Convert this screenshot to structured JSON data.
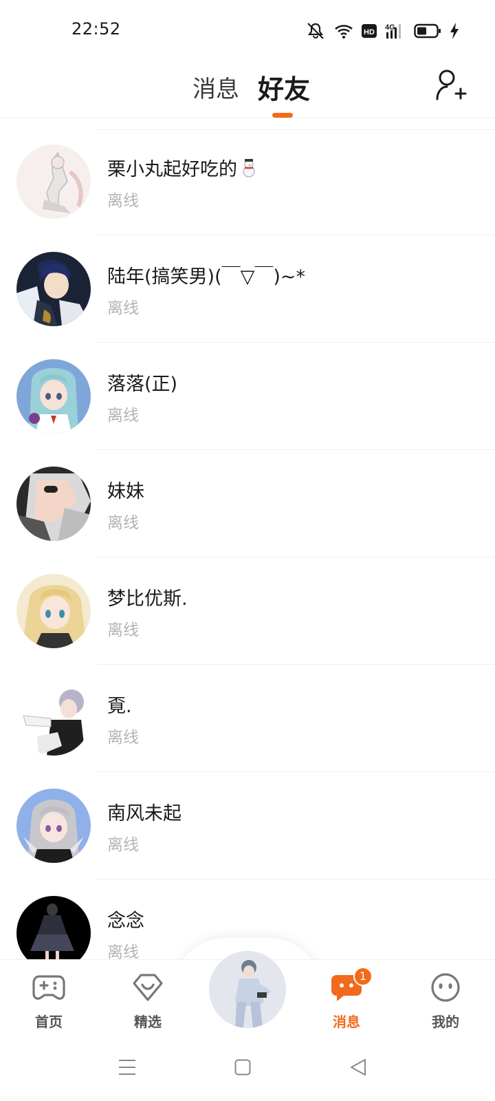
{
  "status_bar": {
    "time": "22:52",
    "icons": [
      "mute-icon",
      "wifi-icon",
      "hd-icon",
      "4g-signal-icon",
      "battery-icon",
      "charging-icon"
    ]
  },
  "header": {
    "tabs": [
      {
        "label": "消息",
        "active": false
      },
      {
        "label": "好友",
        "active": true
      }
    ],
    "accent_color": "#f26a1b",
    "add_friend_icon": "add-person-icon"
  },
  "friends": [
    {
      "name": "栗小丸起好吃的",
      "status": "离线",
      "emoji": "snowman-icon"
    },
    {
      "name": "陆年(搞笑男)(￣▽￣)~*",
      "status": "离线"
    },
    {
      "name": "落落(正)",
      "status": "离线"
    },
    {
      "name": "妹妹",
      "status": "离线"
    },
    {
      "name": "梦比优斯.",
      "status": "离线"
    },
    {
      "name": "覔.",
      "status": "离线"
    },
    {
      "name": "南风未起",
      "status": "离线"
    },
    {
      "name": "念念",
      "status": "离线"
    }
  ],
  "bottom_nav": {
    "items": [
      {
        "label": "首页",
        "icon": "gamepad-icon"
      },
      {
        "label": "精选",
        "icon": "heart-badge-icon"
      },
      {
        "label": "消息",
        "icon": "chat-bubble-icon",
        "active": true,
        "badge": "1"
      },
      {
        "label": "我的",
        "icon": "face-icon"
      }
    ],
    "center": "avatar-character"
  },
  "system_nav": [
    "menu-icon",
    "home-square-icon",
    "back-triangle-icon"
  ]
}
